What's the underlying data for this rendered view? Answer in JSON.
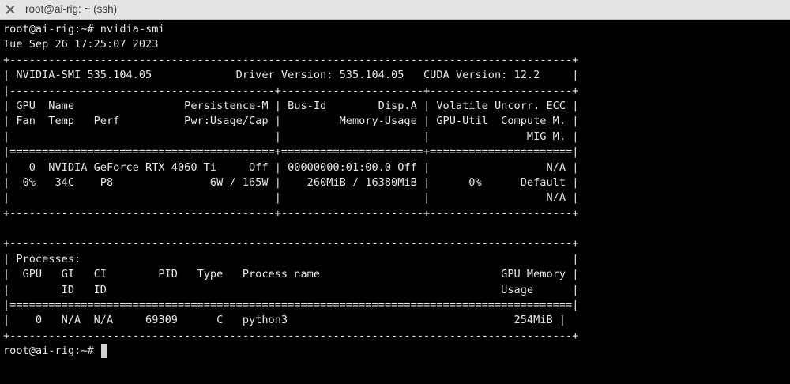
{
  "window": {
    "title": "root@ai-rig: ~ (ssh)"
  },
  "terminal": {
    "lines": [
      "root@ai-rig:~# nvidia-smi",
      "Tue Sep 26 17:25:07 2023",
      "+---------------------------------------------------------------------------------------+",
      "| NVIDIA-SMI 535.104.05             Driver Version: 535.104.05   CUDA Version: 12.2     |",
      "|-----------------------------------------+----------------------+----------------------+",
      "| GPU  Name                 Persistence-M | Bus-Id        Disp.A | Volatile Uncorr. ECC |",
      "| Fan  Temp   Perf          Pwr:Usage/Cap |         Memory-Usage | GPU-Util  Compute M. |",
      "|                                         |                      |               MIG M. |",
      "|=========================================+======================+======================|",
      "|   0  NVIDIA GeForce RTX 4060 Ti     Off | 00000000:01:00.0 Off |                  N/A |",
      "|  0%   34C    P8               6W / 165W |    260MiB / 16380MiB |      0%      Default |",
      "|                                         |                      |                  N/A |",
      "+-----------------------------------------+----------------------+----------------------+",
      "",
      "+---------------------------------------------------------------------------------------+",
      "| Processes:                                                                            |",
      "|  GPU   GI   CI        PID   Type   Process name                            GPU Memory |",
      "|        ID   ID                                                             Usage      |",
      "|=======================================================================================|",
      "|    0   N/A  N/A     69309      C   python3                                   254MiB |",
      "+---------------------------------------------------------------------------------------+"
    ],
    "prompt": "root@ai-rig:~# "
  }
}
